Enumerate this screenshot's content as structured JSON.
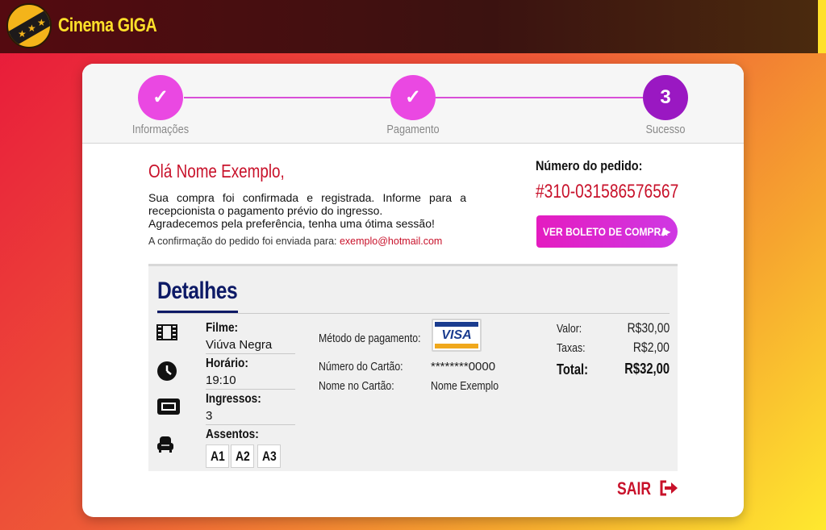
{
  "header": {
    "brand": "Cinema GIGA",
    "logo_icon": "film-strip-logo-icon"
  },
  "stepper": {
    "steps": [
      {
        "label": "Informações",
        "state": "done",
        "mark": "✓"
      },
      {
        "label": "Pagamento",
        "state": "done",
        "mark": "✓"
      },
      {
        "label": "Sucesso",
        "state": "current",
        "mark": "3"
      }
    ]
  },
  "success": {
    "greeting": "Olá Nome Exemplo,",
    "message_line1": "Sua compra foi confirmada e registrada. Informe para a recepcionista o pagamento prévio do ingresso.",
    "message_line2": "Agradecemos pela preferência, tenha uma ótima sessão!",
    "confirmation_prefix": "A confirmação do pedido foi enviada para:",
    "email": "exemplo@hotmail.com"
  },
  "order": {
    "label": "Número do pedido:",
    "number": "#310-031586576567",
    "boleto_button": "VER BOLETO DE COMPRA"
  },
  "details": {
    "title": "Detalhes",
    "movie_label": "Filme:",
    "movie_value": "Viúva Negra",
    "time_label": "Horário:",
    "time_value": "19:10",
    "tickets_label": "Ingressos:",
    "tickets_value": "3",
    "seats_label": "Assentos:",
    "seats": [
      "A1",
      "A2",
      "A3"
    ],
    "payment_method_label": "Método de pagamento:",
    "card_brand": "VISA",
    "card_number_label": "Número do Cartão:",
    "card_number_value": "********0000",
    "card_name_label": "Nome no Cartão:",
    "card_name_value": "Nome Exemplo",
    "value_label": "Valor:",
    "value_amount": "R$30,00",
    "fees_label": "Taxas:",
    "fees_amount": "R$2,00",
    "total_label": "Total:",
    "total_amount": "R$32,00"
  },
  "exit": {
    "label": "SAIR",
    "icon": "sign-out-icon"
  },
  "colors": {
    "accent_red": "#c8112a",
    "step_done": "#ea48e2",
    "step_current": "#9a18c2",
    "details_title": "#0d1a66"
  }
}
